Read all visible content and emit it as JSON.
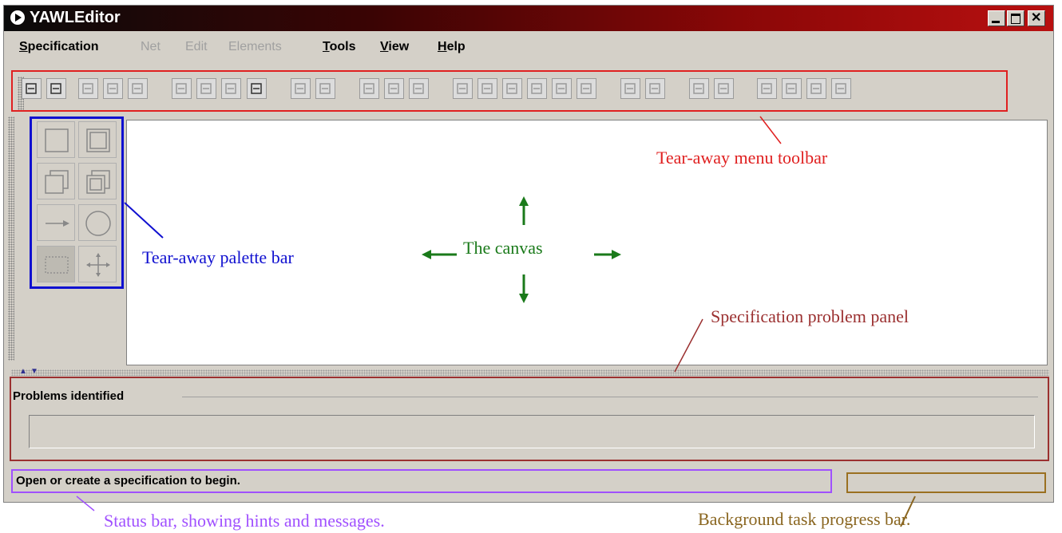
{
  "window": {
    "title": "YAWLEditor"
  },
  "menu": [
    {
      "label": "Specification",
      "enabled": true
    },
    {
      "label": "Net",
      "enabled": false
    },
    {
      "label": "Edit",
      "enabled": false
    },
    {
      "label": "Elements",
      "enabled": false
    },
    {
      "label": "Tools",
      "enabled": true
    },
    {
      "label": "View",
      "enabled": true
    },
    {
      "label": "Help",
      "enabled": true
    }
  ],
  "problems": {
    "title": "Problems identified"
  },
  "status": {
    "message": "Open or create a specification to begin.",
    "progress": 0
  },
  "annotations": {
    "toolbar": "Tear-away menu toolbar",
    "palette": "Tear-away palette bar",
    "canvas": "The canvas",
    "problems": "Specification problem panel",
    "status": "Status bar, showing hints and messages.",
    "progress": "Background task progress bar."
  },
  "colors": {
    "toolbar_annotation": "#e02020",
    "palette_annotation": "#1010d0",
    "canvas_annotation": "#1a7a1a",
    "problems_annotation": "#9b3030",
    "status_annotation": "#a050ff",
    "progress_annotation": "#9a7020",
    "titlebar": "#8a0707"
  },
  "toolbar_icons": [
    "new-spec-icon",
    "open-spec-icon",
    "save-icon",
    "save-as-icon",
    "close-spec-icon",
    "validate-icon",
    "analyse-icon",
    "export-icon",
    "import-icon",
    "create-net-icon",
    "remove-net-icon",
    "undo-icon",
    "redo-icon",
    "delete-icon",
    "align-top-icon",
    "align-middle-icon",
    "align-bottom-icon",
    "align-left-icon",
    "align-center-icon",
    "align-right-icon",
    "add-to-group-icon",
    "remove-from-group-icon",
    "increase-size-icon",
    "decrease-size-icon",
    "zoom-actual-icon",
    "zoom-out-icon",
    "zoom-in-icon",
    "zoom-selected-icon"
  ],
  "palette_icons": [
    "atomic-task-icon",
    "composite-task-icon",
    "multiple-atomic-task-icon",
    "multiple-composite-task-icon",
    "flow-relation-icon",
    "condition-icon",
    "marquee-select-icon",
    "drag-net-icon"
  ]
}
